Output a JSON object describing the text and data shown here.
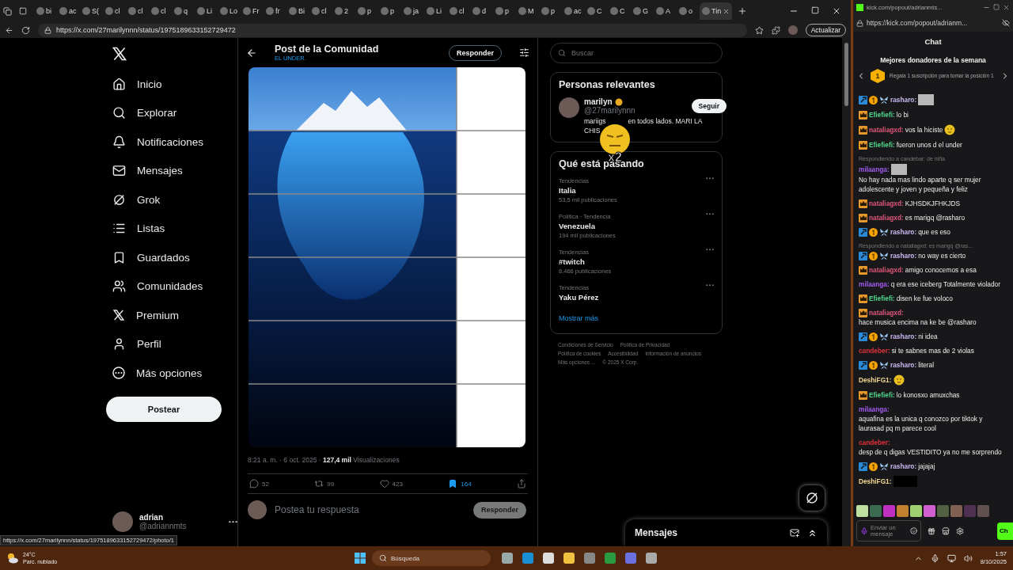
{
  "browser": {
    "tabs": [
      {
        "label": "bi",
        "selected": false
      },
      {
        "label": "ac",
        "selected": false
      },
      {
        "label": "S(",
        "selected": false
      },
      {
        "label": "cl",
        "selected": false
      },
      {
        "label": "cl",
        "selected": false
      },
      {
        "label": "cl",
        "selected": false
      },
      {
        "label": "q",
        "selected": false
      },
      {
        "label": "Li",
        "selected": false
      },
      {
        "label": "Lo",
        "selected": false
      },
      {
        "label": "Fr",
        "selected": false
      },
      {
        "label": "fr",
        "selected": false
      },
      {
        "label": "Bi",
        "selected": false
      },
      {
        "label": "cl",
        "selected": false
      },
      {
        "label": "2",
        "selected": false
      },
      {
        "label": "p",
        "selected": false
      },
      {
        "label": "p",
        "selected": false
      },
      {
        "label": "ja",
        "selected": false
      },
      {
        "label": "Li",
        "selected": false
      },
      {
        "label": "cl",
        "selected": false
      },
      {
        "label": "d",
        "selected": false
      },
      {
        "label": "p",
        "selected": false
      },
      {
        "label": "M",
        "selected": false
      },
      {
        "label": "p",
        "selected": false
      },
      {
        "label": "ac",
        "selected": false
      },
      {
        "label": "C",
        "selected": false
      },
      {
        "label": "C",
        "selected": false
      },
      {
        "label": "G",
        "selected": false
      },
      {
        "label": "A",
        "selected": false
      },
      {
        "label": "o",
        "selected": false
      },
      {
        "label": "Tin",
        "selected": true
      }
    ],
    "url": "https://x.com/27marilynnn/status/1975189633152729472",
    "update_button": "Actualizar",
    "status_url": "https://x.com/27marilynnn/status/1975189633152729472/photo/1"
  },
  "x": {
    "nav": [
      {
        "label": "Inicio"
      },
      {
        "label": "Explorar"
      },
      {
        "label": "Notificaciones"
      },
      {
        "label": "Mensajes"
      },
      {
        "label": "Grok"
      },
      {
        "label": "Listas"
      },
      {
        "label": "Guardados"
      },
      {
        "label": "Comunidades"
      },
      {
        "label": "Premium"
      },
      {
        "label": "Perfil"
      },
      {
        "label": "Más opciones"
      }
    ],
    "post_button": "Postear",
    "account": {
      "name": "adrian",
      "handle": "@adriannmts"
    },
    "post": {
      "title": "Post de la Comunidad",
      "community": "EL UNDER.",
      "reply_button": "Responder",
      "meta": "8:21 a. m. · 6 oct. 2025 · **127,4 mil** Visualizaciones",
      "actions": [
        {
          "count": "52",
          "selected": false
        },
        {
          "count": "99",
          "selected": false
        },
        {
          "count": "423",
          "selected": false
        },
        {
          "count": "164",
          "selected": true
        }
      ],
      "reply_placeholder": "Postea tu respuesta",
      "reply_submit": {
        "label": "Responder",
        "disabled": true
      }
    },
    "search": {
      "placeholder": "Buscar"
    },
    "relevant": {
      "title": "Personas relevantes",
      "people": [
        {
          "name": "marilyn",
          "handle": "@27marilynnn",
          "bio": [
            "mariigs",
            "en todos lados. MARI LA",
            "CHIS"
          ],
          "follow": "Seguir"
        }
      ]
    },
    "trends": {
      "title": "Qué está pasando",
      "items": [
        {
          "category": "Tendencias",
          "name": "Italia",
          "count": "53,5 mil publicaciones"
        },
        {
          "category": "Política · Tendencia",
          "name": "Venezuela",
          "count": "194 mil publicaciones"
        },
        {
          "category": "Tendencias",
          "name": "#twitch",
          "count": "8.466 publicaciones"
        },
        {
          "category": "Tendencias",
          "name": "Yaku Pérez"
        }
      ],
      "more": "Mostrar más"
    },
    "footer": {
      "links": [
        "Condiciones de Servicio",
        "Política de Privacidad",
        "Política de cookies",
        "Accesibilidad",
        "Información de anuncios",
        "Más opciones ..."
      ],
      "copyright": "© 2025 X Corp."
    },
    "messages_drawer": {
      "title": "Mensajes"
    }
  },
  "overlay": {
    "label": "x2"
  },
  "chat": {
    "window_title": "kick.com/popout/adrianmts...",
    "url": "https://kick.com/popout/adrianm...",
    "title": "Chat",
    "donors": {
      "title": "Mejores donadores de la semana",
      "rank": "1",
      "text": "Regala 1 suscripción para tomar la posición 1"
    },
    "messages": [
      {
        "user": "rasharo:",
        "color": "#c9b8f0",
        "badges": [
          {
            "kind": "mod"
          },
          {
            "kind": "coin"
          },
          {
            "kind": "wings"
          }
        ],
        "attachment": {
          "kind": "image"
        }
      },
      {
        "user": "Efiefiefi:",
        "color": "#4fd68a",
        "badges": [
          {
            "kind": "crown"
          }
        ],
        "text": "lo bi"
      },
      {
        "user": "nataliagxd:",
        "color": "#e0557a",
        "badges": [
          {
            "kind": "crown"
          }
        ],
        "text": "vos la hiciste",
        "attachment": {
          "kind": "emote"
        }
      },
      {
        "user": "Efiefiefi:",
        "color": "#4fd68a",
        "badges": [
          {
            "kind": "crown"
          }
        ],
        "text": "fueron unos d el under"
      },
      {
        "reply": "Respondiendo a candebar: de niña",
        "user": "milaanga:",
        "color": "#a35cf0",
        "attachment": {
          "kind": "image"
        },
        "text": "No hay nada mas lindo aparte q ser mujer adolescente y joven y pequeña y feliz"
      },
      {
        "user": "nataliagxd:",
        "color": "#e0557a",
        "badges": [
          {
            "kind": "crown"
          }
        ],
        "text": "KJHSDKJFHKJDS"
      },
      {
        "user": "nataliagxd:",
        "color": "#e0557a",
        "badges": [
          {
            "kind": "crown"
          }
        ],
        "text": "es marigq @rasharo"
      },
      {
        "user": "rasharo:",
        "color": "#c9b8f0",
        "badges": [
          {
            "kind": "mod"
          },
          {
            "kind": "coin"
          },
          {
            "kind": "wings"
          }
        ],
        "text": "que es eso"
      },
      {
        "reply": "Respondiendo a nataliagxd: es marigq @ras...",
        "user": "rasharo:",
        "color": "#c9b8f0",
        "badges": [
          {
            "kind": "mod"
          },
          {
            "kind": "coin"
          },
          {
            "kind": "wings"
          }
        ],
        "text": "no way es cierto"
      },
      {
        "user": "nataliagxd:",
        "color": "#e0557a",
        "badges": [
          {
            "kind": "crown"
          }
        ],
        "text": "amigo conocemos a esa"
      },
      {
        "user": "milaanga:",
        "color": "#a35cf0",
        "text": "q era ese iceberg Totalmente violador"
      },
      {
        "user": "Efiefiefi:",
        "color": "#4fd68a",
        "badges": [
          {
            "kind": "crown"
          }
        ],
        "text": "disen ke fue voloco"
      },
      {
        "user": "nataliagxd:",
        "color": "#e0557a",
        "badges": [
          {
            "kind": "crown"
          }
        ],
        "text": "hace musica encima na ke be @rasharo"
      },
      {
        "user": "rasharo:",
        "color": "#c9b8f0",
        "badges": [
          {
            "kind": "mod"
          },
          {
            "kind": "coin"
          },
          {
            "kind": "wings"
          }
        ],
        "text": "ni idea"
      },
      {
        "user": "candeber:",
        "color": "#e0303a",
        "text": "si te sabnes mas de 2 violas"
      },
      {
        "user": "rasharo:",
        "color": "#c9b8f0",
        "badges": [
          {
            "kind": "mod"
          },
          {
            "kind": "coin"
          },
          {
            "kind": "wings"
          }
        ],
        "text": "literal"
      },
      {
        "user": "DeshiFG1:",
        "color": "#f0d890",
        "attachment": {
          "kind": "emote"
        }
      },
      {
        "user": "Efiefiefi:",
        "color": "#4fd68a",
        "badges": [
          {
            "kind": "crown"
          }
        ],
        "text": "lo konosxo amuxchas"
      },
      {
        "user": "milaanga:",
        "color": "#a35cf0",
        "text": "aquafina es la unica q conozco por tiktok y laurasad pq m parece cool"
      },
      {
        "user": "candeber:",
        "color": "#e0303a",
        "text": "desp de q digas VESTIDITO ya no me sorprendo"
      },
      {
        "user": "rasharo:",
        "color": "#c9b8f0",
        "badges": [
          {
            "kind": "mod"
          },
          {
            "kind": "coin"
          },
          {
            "kind": "wings"
          }
        ],
        "text": "jajajaj"
      },
      {
        "user": "DeshiFG1:",
        "color": "#f0d890",
        "attachment": {
          "kind": "block"
        }
      }
    ],
    "input_placeholder": "Enviar un mensaje",
    "send": "Ch"
  },
  "taskbar": {
    "weather": {
      "temp": "24°C",
      "desc": "Parc. nublado"
    },
    "search": "Búsqueda",
    "time": "1:57",
    "date": "8/10/2025"
  }
}
